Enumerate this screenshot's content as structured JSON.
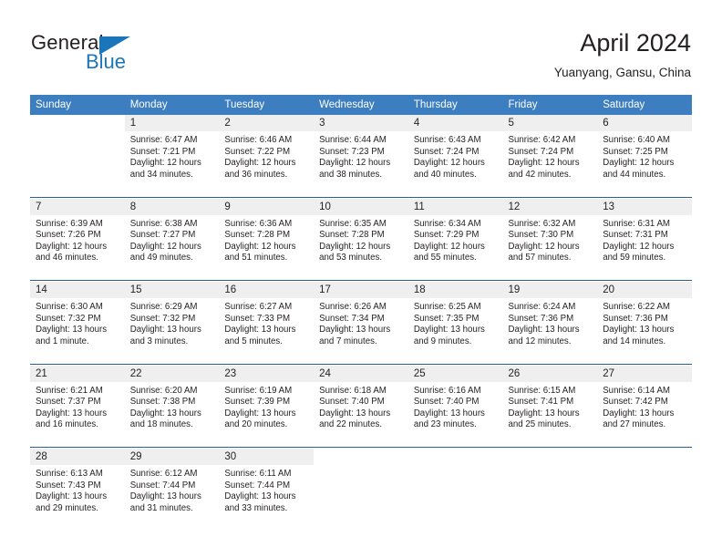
{
  "logo": {
    "word1": "General",
    "word2": "Blue",
    "triangle_color": "#1b75bb"
  },
  "header": {
    "title": "April 2024",
    "subtitle": "Yuanyang, Gansu, China"
  },
  "theme": {
    "header_bg": "#3c7ebf",
    "daynum_bg": "#efefef",
    "separator": "#2a5f93",
    "text": "#231f20"
  },
  "weekdays": [
    "Sunday",
    "Monday",
    "Tuesday",
    "Wednesday",
    "Thursday",
    "Friday",
    "Saturday"
  ],
  "labels": {
    "sunrise_prefix": "Sunrise: ",
    "sunset_prefix": "Sunset: ",
    "daylight_prefix": "Daylight: "
  },
  "weeks": [
    {
      "days": [
        {
          "num": "",
          "sunrise": "",
          "sunset": "",
          "daylight_line1": "",
          "daylight_line2": ""
        },
        {
          "num": "1",
          "sunrise": "Sunrise: 6:47 AM",
          "sunset": "Sunset: 7:21 PM",
          "daylight_line1": "Daylight: 12 hours",
          "daylight_line2": "and 34 minutes."
        },
        {
          "num": "2",
          "sunrise": "Sunrise: 6:46 AM",
          "sunset": "Sunset: 7:22 PM",
          "daylight_line1": "Daylight: 12 hours",
          "daylight_line2": "and 36 minutes."
        },
        {
          "num": "3",
          "sunrise": "Sunrise: 6:44 AM",
          "sunset": "Sunset: 7:23 PM",
          "daylight_line1": "Daylight: 12 hours",
          "daylight_line2": "and 38 minutes."
        },
        {
          "num": "4",
          "sunrise": "Sunrise: 6:43 AM",
          "sunset": "Sunset: 7:24 PM",
          "daylight_line1": "Daylight: 12 hours",
          "daylight_line2": "and 40 minutes."
        },
        {
          "num": "5",
          "sunrise": "Sunrise: 6:42 AM",
          "sunset": "Sunset: 7:24 PM",
          "daylight_line1": "Daylight: 12 hours",
          "daylight_line2": "and 42 minutes."
        },
        {
          "num": "6",
          "sunrise": "Sunrise: 6:40 AM",
          "sunset": "Sunset: 7:25 PM",
          "daylight_line1": "Daylight: 12 hours",
          "daylight_line2": "and 44 minutes."
        }
      ]
    },
    {
      "days": [
        {
          "num": "7",
          "sunrise": "Sunrise: 6:39 AM",
          "sunset": "Sunset: 7:26 PM",
          "daylight_line1": "Daylight: 12 hours",
          "daylight_line2": "and 46 minutes."
        },
        {
          "num": "8",
          "sunrise": "Sunrise: 6:38 AM",
          "sunset": "Sunset: 7:27 PM",
          "daylight_line1": "Daylight: 12 hours",
          "daylight_line2": "and 49 minutes."
        },
        {
          "num": "9",
          "sunrise": "Sunrise: 6:36 AM",
          "sunset": "Sunset: 7:28 PM",
          "daylight_line1": "Daylight: 12 hours",
          "daylight_line2": "and 51 minutes."
        },
        {
          "num": "10",
          "sunrise": "Sunrise: 6:35 AM",
          "sunset": "Sunset: 7:28 PM",
          "daylight_line1": "Daylight: 12 hours",
          "daylight_line2": "and 53 minutes."
        },
        {
          "num": "11",
          "sunrise": "Sunrise: 6:34 AM",
          "sunset": "Sunset: 7:29 PM",
          "daylight_line1": "Daylight: 12 hours",
          "daylight_line2": "and 55 minutes."
        },
        {
          "num": "12",
          "sunrise": "Sunrise: 6:32 AM",
          "sunset": "Sunset: 7:30 PM",
          "daylight_line1": "Daylight: 12 hours",
          "daylight_line2": "and 57 minutes."
        },
        {
          "num": "13",
          "sunrise": "Sunrise: 6:31 AM",
          "sunset": "Sunset: 7:31 PM",
          "daylight_line1": "Daylight: 12 hours",
          "daylight_line2": "and 59 minutes."
        }
      ]
    },
    {
      "days": [
        {
          "num": "14",
          "sunrise": "Sunrise: 6:30 AM",
          "sunset": "Sunset: 7:32 PM",
          "daylight_line1": "Daylight: 13 hours",
          "daylight_line2": "and 1 minute."
        },
        {
          "num": "15",
          "sunrise": "Sunrise: 6:29 AM",
          "sunset": "Sunset: 7:32 PM",
          "daylight_line1": "Daylight: 13 hours",
          "daylight_line2": "and 3 minutes."
        },
        {
          "num": "16",
          "sunrise": "Sunrise: 6:27 AM",
          "sunset": "Sunset: 7:33 PM",
          "daylight_line1": "Daylight: 13 hours",
          "daylight_line2": "and 5 minutes."
        },
        {
          "num": "17",
          "sunrise": "Sunrise: 6:26 AM",
          "sunset": "Sunset: 7:34 PM",
          "daylight_line1": "Daylight: 13 hours",
          "daylight_line2": "and 7 minutes."
        },
        {
          "num": "18",
          "sunrise": "Sunrise: 6:25 AM",
          "sunset": "Sunset: 7:35 PM",
          "daylight_line1": "Daylight: 13 hours",
          "daylight_line2": "and 9 minutes."
        },
        {
          "num": "19",
          "sunrise": "Sunrise: 6:24 AM",
          "sunset": "Sunset: 7:36 PM",
          "daylight_line1": "Daylight: 13 hours",
          "daylight_line2": "and 12 minutes."
        },
        {
          "num": "20",
          "sunrise": "Sunrise: 6:22 AM",
          "sunset": "Sunset: 7:36 PM",
          "daylight_line1": "Daylight: 13 hours",
          "daylight_line2": "and 14 minutes."
        }
      ]
    },
    {
      "days": [
        {
          "num": "21",
          "sunrise": "Sunrise: 6:21 AM",
          "sunset": "Sunset: 7:37 PM",
          "daylight_line1": "Daylight: 13 hours",
          "daylight_line2": "and 16 minutes."
        },
        {
          "num": "22",
          "sunrise": "Sunrise: 6:20 AM",
          "sunset": "Sunset: 7:38 PM",
          "daylight_line1": "Daylight: 13 hours",
          "daylight_line2": "and 18 minutes."
        },
        {
          "num": "23",
          "sunrise": "Sunrise: 6:19 AM",
          "sunset": "Sunset: 7:39 PM",
          "daylight_line1": "Daylight: 13 hours",
          "daylight_line2": "and 20 minutes."
        },
        {
          "num": "24",
          "sunrise": "Sunrise: 6:18 AM",
          "sunset": "Sunset: 7:40 PM",
          "daylight_line1": "Daylight: 13 hours",
          "daylight_line2": "and 22 minutes."
        },
        {
          "num": "25",
          "sunrise": "Sunrise: 6:16 AM",
          "sunset": "Sunset: 7:40 PM",
          "daylight_line1": "Daylight: 13 hours",
          "daylight_line2": "and 23 minutes."
        },
        {
          "num": "26",
          "sunrise": "Sunrise: 6:15 AM",
          "sunset": "Sunset: 7:41 PM",
          "daylight_line1": "Daylight: 13 hours",
          "daylight_line2": "and 25 minutes."
        },
        {
          "num": "27",
          "sunrise": "Sunrise: 6:14 AM",
          "sunset": "Sunset: 7:42 PM",
          "daylight_line1": "Daylight: 13 hours",
          "daylight_line2": "and 27 minutes."
        }
      ]
    },
    {
      "days": [
        {
          "num": "28",
          "sunrise": "Sunrise: 6:13 AM",
          "sunset": "Sunset: 7:43 PM",
          "daylight_line1": "Daylight: 13 hours",
          "daylight_line2": "and 29 minutes."
        },
        {
          "num": "29",
          "sunrise": "Sunrise: 6:12 AM",
          "sunset": "Sunset: 7:44 PM",
          "daylight_line1": "Daylight: 13 hours",
          "daylight_line2": "and 31 minutes."
        },
        {
          "num": "30",
          "sunrise": "Sunrise: 6:11 AM",
          "sunset": "Sunset: 7:44 PM",
          "daylight_line1": "Daylight: 13 hours",
          "daylight_line2": "and 33 minutes."
        },
        {
          "num": "",
          "sunrise": "",
          "sunset": "",
          "daylight_line1": "",
          "daylight_line2": ""
        },
        {
          "num": "",
          "sunrise": "",
          "sunset": "",
          "daylight_line1": "",
          "daylight_line2": ""
        },
        {
          "num": "",
          "sunrise": "",
          "sunset": "",
          "daylight_line1": "",
          "daylight_line2": ""
        },
        {
          "num": "",
          "sunrise": "",
          "sunset": "",
          "daylight_line1": "",
          "daylight_line2": ""
        }
      ]
    }
  ]
}
